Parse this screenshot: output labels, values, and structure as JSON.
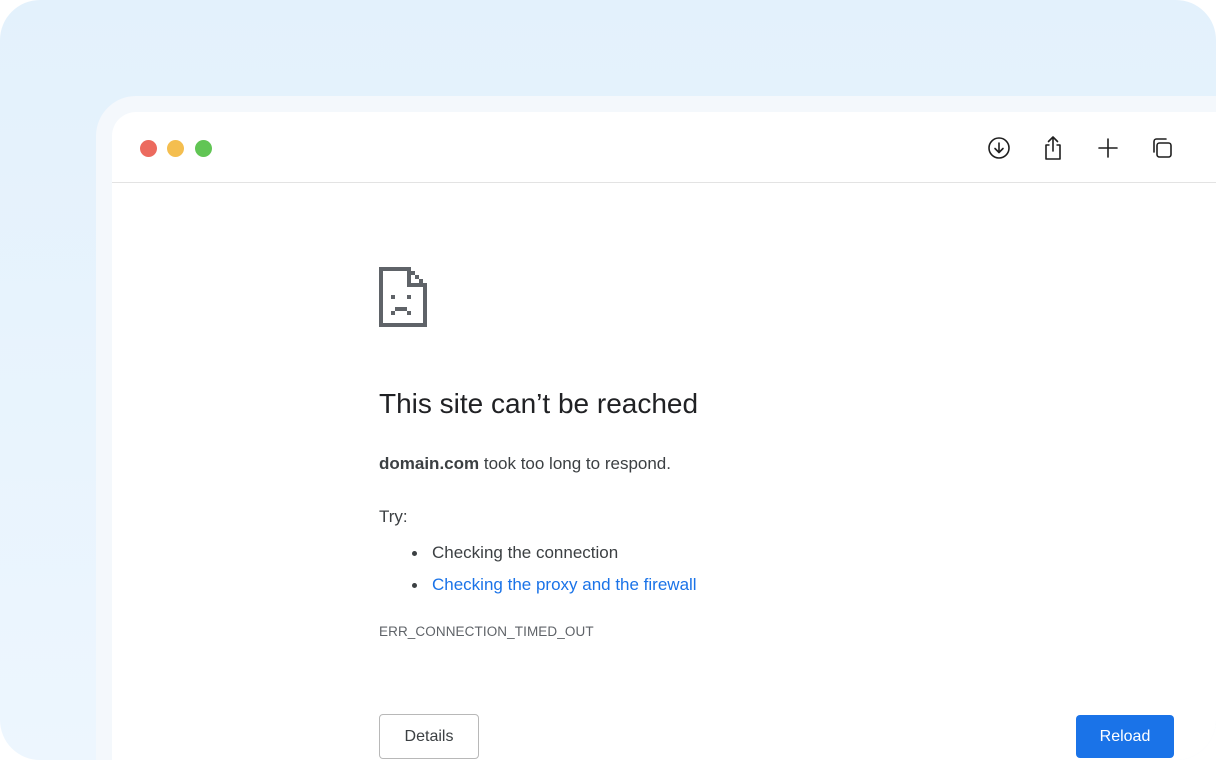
{
  "window": {
    "controls": [
      "close",
      "minimize",
      "zoom"
    ],
    "toolbar_icons": [
      "download-icon",
      "share-icon",
      "plus-icon",
      "tabs-overview-icon"
    ]
  },
  "error_page": {
    "icon": "sad-page-icon",
    "heading": "This site can’t be reached",
    "domain": "domain.com",
    "message": " took too long to respond.",
    "try_label": "Try:",
    "suggestions": [
      {
        "text": "Checking the connection",
        "is_link": false
      },
      {
        "text": "Checking the proxy and the firewall",
        "is_link": true
      }
    ],
    "error_code": "ERR_CONNECTION_TIMED_OUT",
    "details_button": "Details",
    "reload_button": "Reload"
  },
  "colors": {
    "link": "#1a73e8",
    "reload_button": "#1a73e8",
    "traffic_red": "#ec6a5e",
    "traffic_yellow": "#f4be4f",
    "traffic_green": "#61c554"
  }
}
